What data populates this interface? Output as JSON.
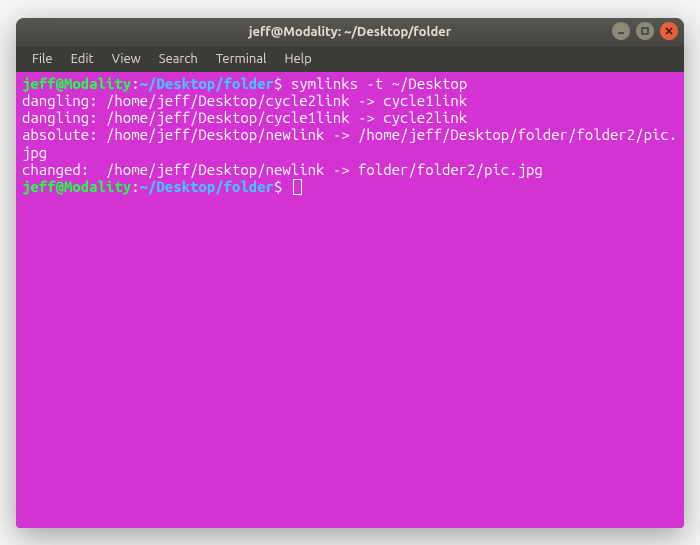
{
  "window": {
    "title": "jeff@Modality: ~/Desktop/folder"
  },
  "menubar": {
    "items": [
      "File",
      "Edit",
      "View",
      "Search",
      "Terminal",
      "Help"
    ]
  },
  "terminal": {
    "prompt_user_host": "jeff@Modality",
    "prompt_path": "~/Desktop/folder",
    "prompt_sep1": ":",
    "prompt_sep2": "$ ",
    "command1": "symlinks -t ~/Desktop",
    "output_lines": [
      "dangling: /home/jeff/Desktop/cycle2link -> cycle1link",
      "dangling: /home/jeff/Desktop/cycle1link -> cycle2link",
      "absolute: /home/jeff/Desktop/newlink -> /home/jeff/Desktop/folder/folder2/pic.jpg",
      "changed:  /home/jeff/Desktop/newlink -> folder/folder2/pic.jpg"
    ]
  }
}
